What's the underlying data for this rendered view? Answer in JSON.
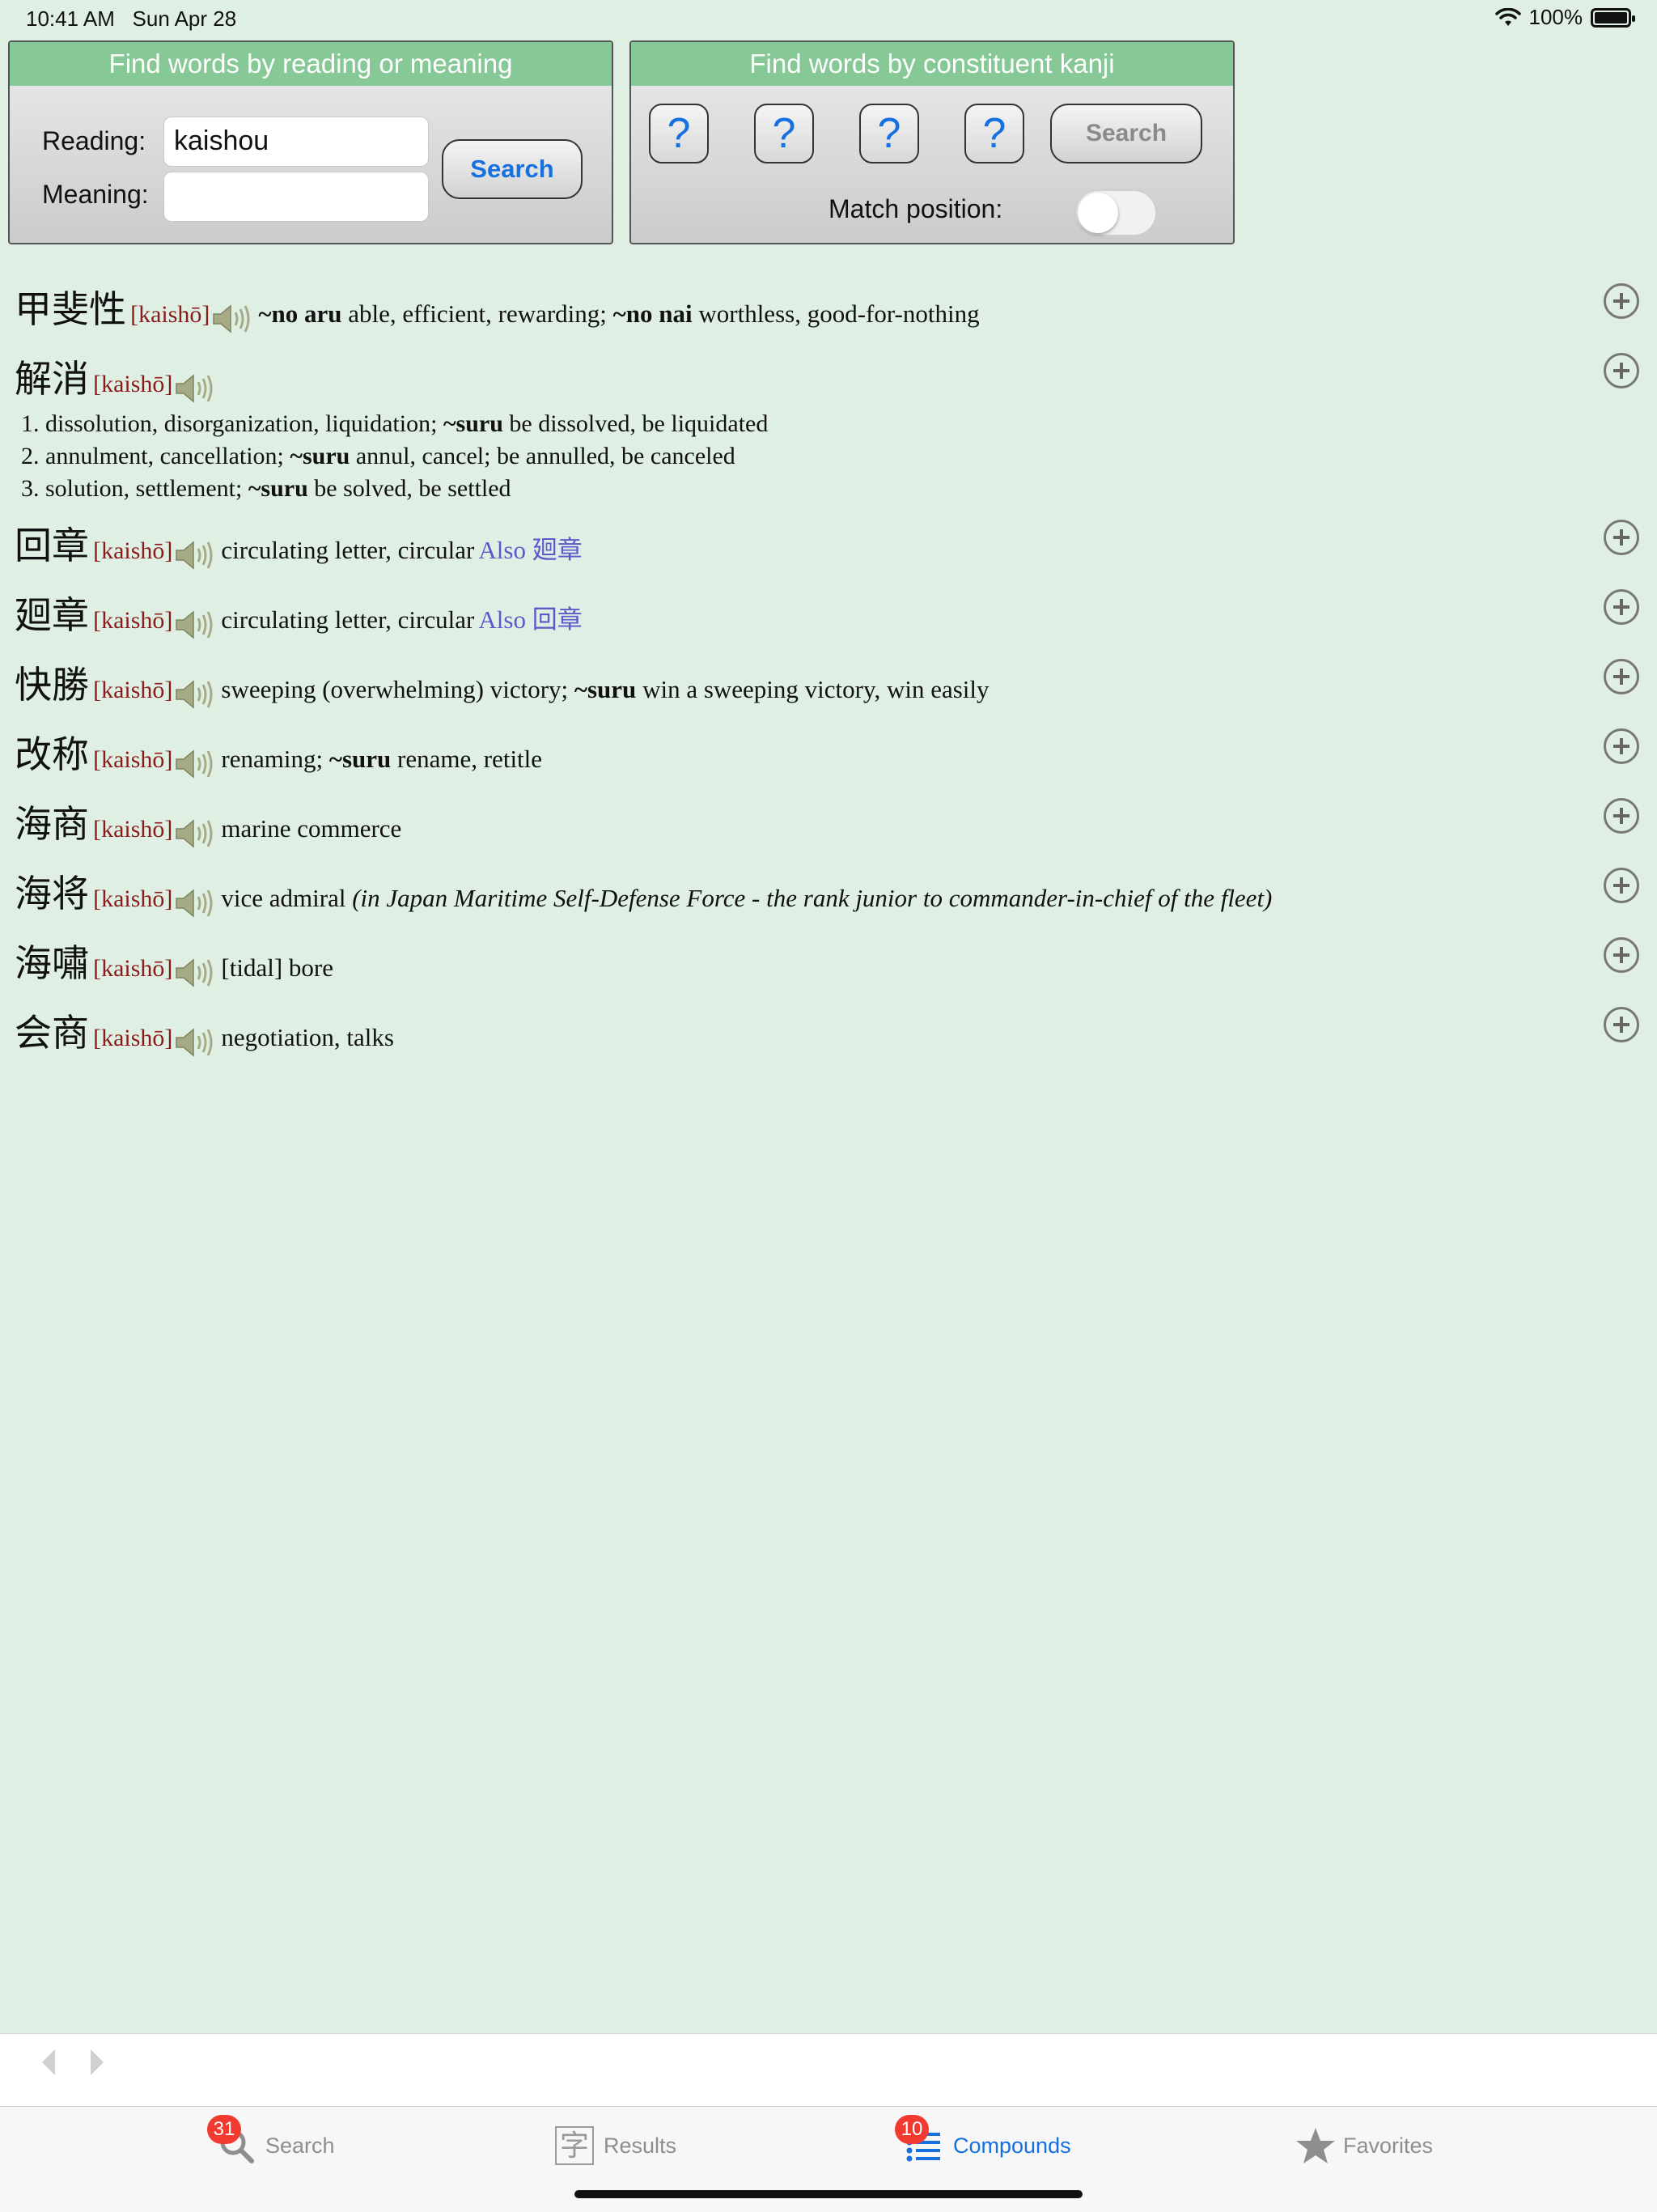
{
  "status": {
    "time": "10:41 AM",
    "date": "Sun Apr 28",
    "battery": "100%"
  },
  "reading_panel": {
    "title": "Find words by reading or meaning",
    "reading_label": "Reading:",
    "reading_value": "kaishou",
    "meaning_label": "Meaning:",
    "meaning_value": "",
    "search_label": "Search"
  },
  "kanji_panel": {
    "title": "Find words by constituent kanji",
    "slots": [
      "?",
      "?",
      "?",
      "?"
    ],
    "search_label": "Search",
    "match_label": "Match position:",
    "match_on": false
  },
  "results": [
    {
      "kanji": "甲斐性",
      "reading": "[kaishō]"
    },
    {
      "kanji": "解消",
      "reading": "[kaishō]",
      "senses": [
        {
          "n": "1.",
          "a": "dissolution, disorganization, liquidation; ",
          "b": "~suru",
          "c": " be dissolved, be liquidated"
        },
        {
          "n": "2.",
          "a": "annulment, cancellation; ",
          "b": "~suru",
          "c": " annul, cancel; be annulled, be canceled"
        },
        {
          "n": "3.",
          "a": "solution, settlement; ",
          "b": "~suru",
          "c": " be solved, be settled"
        }
      ]
    },
    {
      "kanji": "回章",
      "reading": "[kaishō]",
      "def": "circulating letter, circular",
      "also": "Also 廻章"
    },
    {
      "kanji": "廻章",
      "reading": "[kaishō]",
      "def": "circulating letter, circular",
      "also": "Also 回章"
    },
    {
      "kanji": "快勝",
      "reading": "[kaishō]",
      "def_a": "sweeping (overwhelming) victory; ",
      "def_b": "~suru",
      "def_c": " win a sweeping victory, win easily"
    },
    {
      "kanji": "改称",
      "reading": "[kaishō]",
      "def_a": "renaming; ",
      "def_b": "~suru",
      "def_c": " rename, retitle"
    },
    {
      "kanji": "海商",
      "reading": "[kaishō]",
      "def": "marine commerce"
    },
    {
      "kanji": "海将",
      "reading": "[kaishō]",
      "def": "vice admiral ",
      "def_i": "(in Japan Maritime Self-Defense Force - the rank junior to commander-in-chief of the fleet)"
    },
    {
      "kanji": "海嘯",
      "reading": "[kaishō]",
      "def": "[tidal] bore"
    },
    {
      "kanji": "会商",
      "reading": "[kaishō]",
      "def": "negotiation, talks"
    }
  ],
  "first_def": {
    "b1": "~no aru",
    "t1": " able, efficient, rewarding; ",
    "b2": "~no nai",
    "t2": " worthless, good-for-nothing"
  },
  "tabs": [
    {
      "label": "Search",
      "badge": "31",
      "icon": "magnifier-icon"
    },
    {
      "label": "Results",
      "icon": "kanji-icon",
      "glyph": "字"
    },
    {
      "label": "Compounds",
      "badge": "10",
      "icon": "list-icon"
    },
    {
      "label": "Favorites",
      "icon": "star-icon"
    }
  ],
  "colors": {
    "background": "#dfefe3",
    "panel_header": "#87c897",
    "reading": "#8b1a1a",
    "accent": "#1670e0",
    "badge": "#f23b30"
  }
}
